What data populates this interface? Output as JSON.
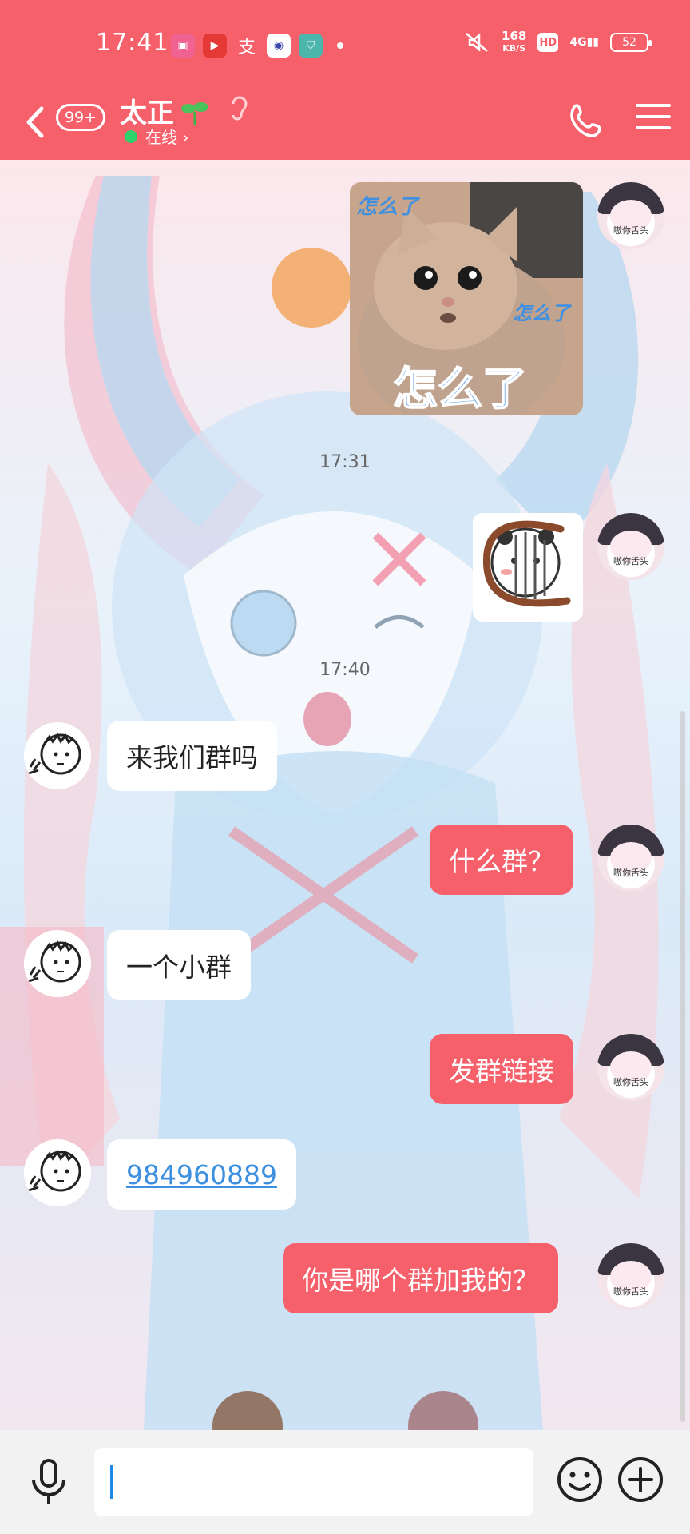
{
  "status_bar": {
    "time": "17:41",
    "speed_value": "168",
    "speed_unit": "KB/S",
    "hd_label": "HD",
    "signal_label": "4G",
    "battery": "52"
  },
  "nav": {
    "unread_badge": "99+",
    "contact_name": "太正",
    "online_status": "在线 ›"
  },
  "avatar_caption": "嗷你舌头",
  "timestamps": [
    "17:31",
    "17:40"
  ],
  "stickers": {
    "cat_caption_top": "怎么了",
    "cat_caption_right": "怎么了",
    "cat_caption_main": "怎么了"
  },
  "messages": [
    {
      "side": "in",
      "text": "来我们群吗"
    },
    {
      "side": "out",
      "text": "什么群？"
    },
    {
      "side": "in",
      "text": "一个小群"
    },
    {
      "side": "out",
      "text": "发群链接"
    },
    {
      "side": "in",
      "text": "984960889"
    },
    {
      "side": "out",
      "text": "你是哪个群加我的？"
    }
  ],
  "input": {
    "value": "",
    "placeholder": ""
  },
  "colors": {
    "accent": "#f5606b",
    "link": "#3d8fdf",
    "online": "#2fd26b"
  }
}
